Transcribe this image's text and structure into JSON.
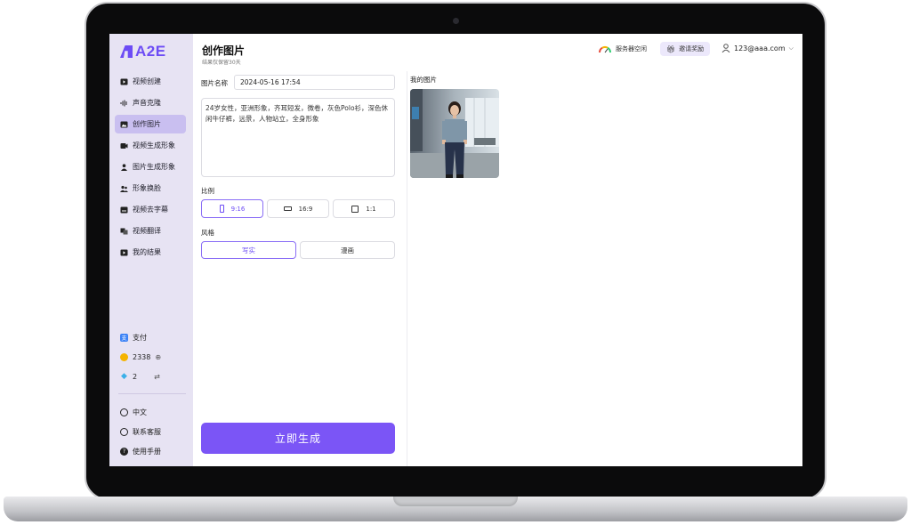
{
  "app": {
    "logo_text": "A2E"
  },
  "sidebar": {
    "items": [
      {
        "label": "视频创建",
        "icon": "video-icon",
        "active": false
      },
      {
        "label": "声音克隆",
        "icon": "waveform-icon",
        "active": false
      },
      {
        "label": "创作图片",
        "icon": "image-icon",
        "active": true
      },
      {
        "label": "视频生成形象",
        "icon": "video-avatar-icon",
        "active": false
      },
      {
        "label": "图片生成形象",
        "icon": "image-avatar-icon",
        "active": false
      },
      {
        "label": "形象换脸",
        "icon": "face-swap-icon",
        "active": false
      },
      {
        "label": "视频去字幕",
        "icon": "subtitle-remove-icon",
        "active": false
      },
      {
        "label": "视频翻译",
        "icon": "translate-icon",
        "active": false
      },
      {
        "label": "我的结果",
        "icon": "results-icon",
        "active": false
      }
    ],
    "pay_label": "支付",
    "coins": "2338",
    "gems": "2",
    "language": "中文",
    "support": "联系客服",
    "manual": "使用手册"
  },
  "header": {
    "title": "创作图片",
    "subtitle": "结果仅保留30天",
    "server_status": "服务器空闲",
    "invite_label": "邀请奖励",
    "user_email": "123@aaa.com"
  },
  "form": {
    "name_label": "图片名称",
    "name_value": "2024-05-16 17:54",
    "prompt_value": "24岁女性，亚洲形象，齐耳短发，微卷，灰色Polo衫，深色休闲牛仔裤，远景，人物站立，全身形象",
    "ratio_label": "比例",
    "ratios": [
      {
        "label": "9:16",
        "active": true
      },
      {
        "label": "16:9",
        "active": false
      },
      {
        "label": "1:1",
        "active": false
      }
    ],
    "style_label": "风格",
    "styles": [
      {
        "label": "写实",
        "active": true
      },
      {
        "label": "漫画",
        "active": false
      }
    ],
    "generate_label": "立即生成"
  },
  "results": {
    "title": "我的图片"
  },
  "colors": {
    "accent": "#7b55f6",
    "sidebar_bg": "#e7e3f3",
    "active_item": "#c9bff0"
  }
}
